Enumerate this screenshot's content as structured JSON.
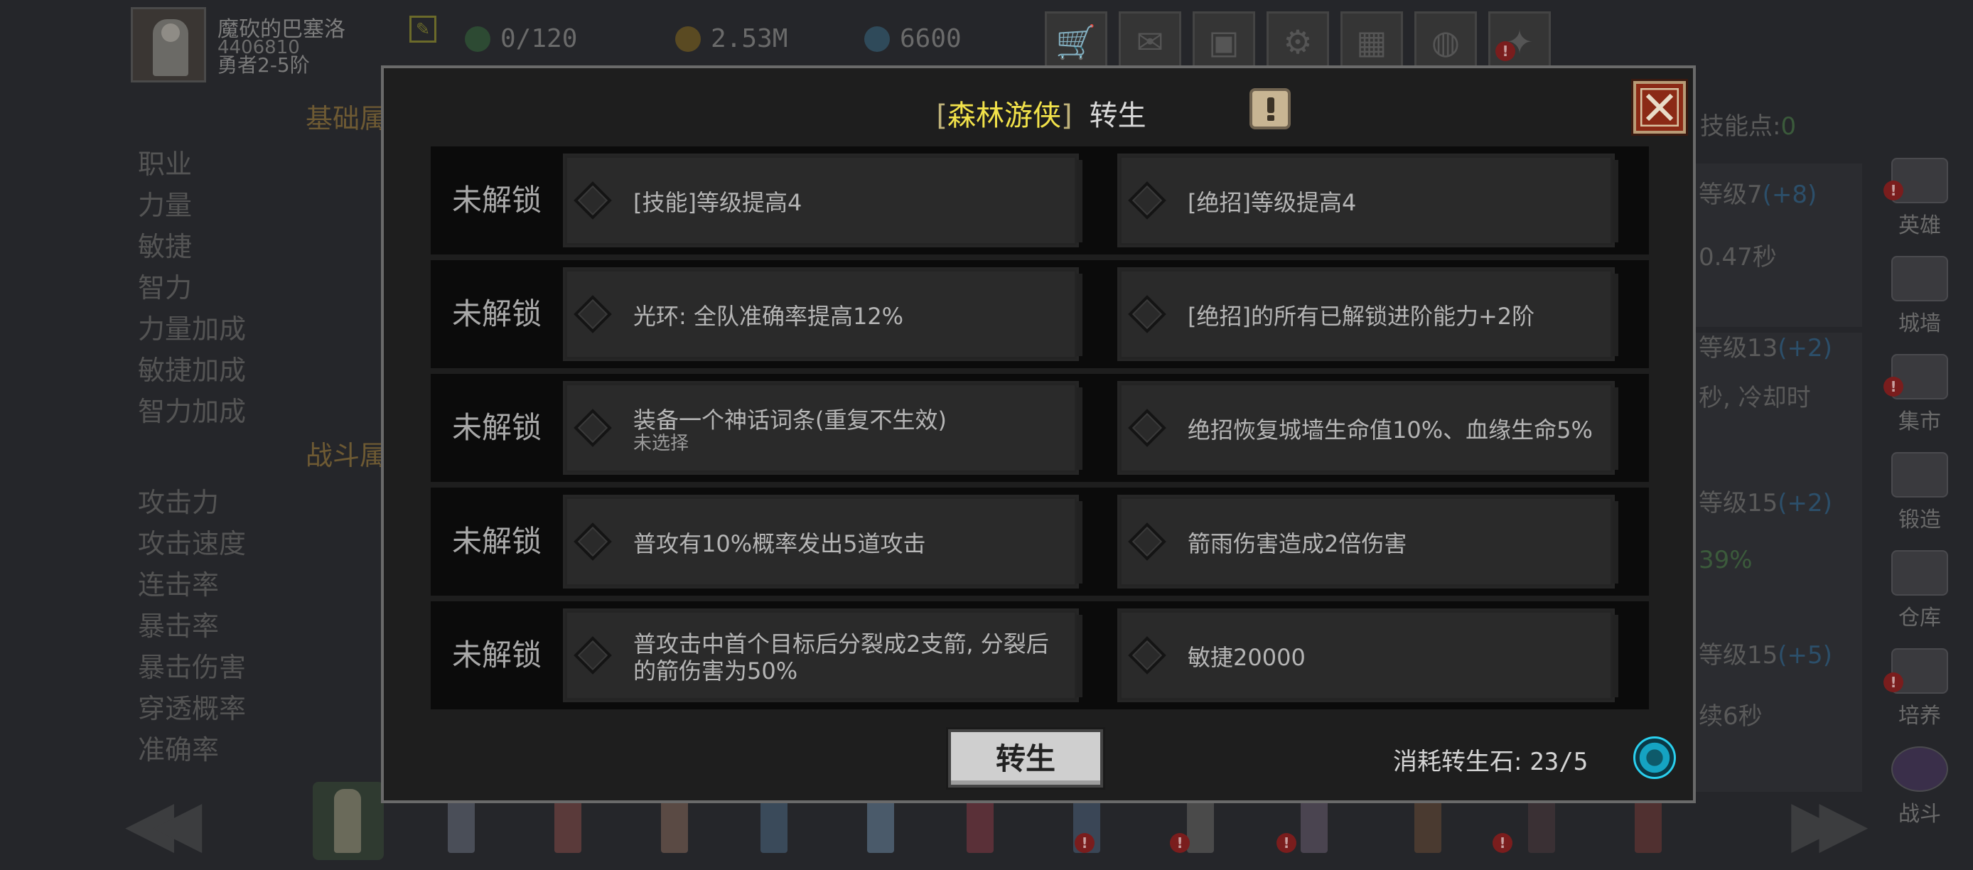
{
  "player": {
    "name": "魔砍的巴塞洛",
    "id": "4406810",
    "rank": "勇者2-5阶"
  },
  "resources": {
    "energy": "0/120",
    "gold": "2.53M",
    "gems": "6600"
  },
  "top_buttons": [
    "cart-icon",
    "mail-icon",
    "gamepad-icon",
    "gear-icon",
    "gift-icon",
    "color-wheel-icon",
    "sparkle-icon"
  ],
  "background": {
    "section_basic": "基础属",
    "section_battle": "战斗属",
    "basic_stats": [
      "职业",
      "力量",
      "敏捷",
      "智力",
      "力量加成",
      "敏捷加成",
      "智力加成"
    ],
    "battle_stats": [
      "攻击力",
      "攻击速度",
      "连击率",
      "暴击率",
      "暴击伤害",
      "穿透概率",
      "准确率"
    ],
    "skill_points_label": "技能点:",
    "skill_points_value": "0",
    "right_panel": [
      {
        "level": "等级7",
        "bonus": "(+8)",
        "detail": "0.47秒"
      },
      {
        "level": "等级13",
        "bonus": "(+2)",
        "detail": "秒, 冷却时"
      },
      {
        "level": "等级15",
        "bonus": "(+2)",
        "detail": "39%"
      },
      {
        "level": "等级15",
        "bonus": "(+5)",
        "detail": "续6秒"
      }
    ],
    "side_menu": [
      "英雄",
      "城墙",
      "集市",
      "锻造",
      "仓库",
      "培养",
      "战斗"
    ]
  },
  "modal": {
    "title_open": "[",
    "class_name": "森林游侠",
    "title_close": "]",
    "title_action": "转生",
    "rows": [
      {
        "status": "未解锁",
        "left": "[技能]等级提高4",
        "left_sub": "",
        "right": "[绝招]等级提高4"
      },
      {
        "status": "未解锁",
        "left": "光环: 全队准确率提高12%",
        "left_sub": "",
        "right": "[绝招]的所有已解锁进阶能力+2阶"
      },
      {
        "status": "未解锁",
        "left": "装备一个神话词条(重复不生效)",
        "left_sub": "未选择",
        "right": "绝招恢复城墙生命值10%、血缘生命5%"
      },
      {
        "status": "未解锁",
        "left": "普攻有10%概率发出5道攻击",
        "left_sub": "",
        "right": "箭雨伤害造成2倍伤害"
      },
      {
        "status": "未解锁",
        "left": "普攻击中首个目标后分裂成2支箭, 分裂后的箭伤害为50%",
        "left_sub": "",
        "right": "敏捷20000"
      }
    ],
    "rebirth_button": "转生",
    "cost_label": "消耗转生石:",
    "cost_value": "23/5"
  },
  "colors": {
    "accent_yellow": "#f2e24a",
    "close_red": "#8b2a16",
    "stone_cyan": "#2ad0ef"
  }
}
